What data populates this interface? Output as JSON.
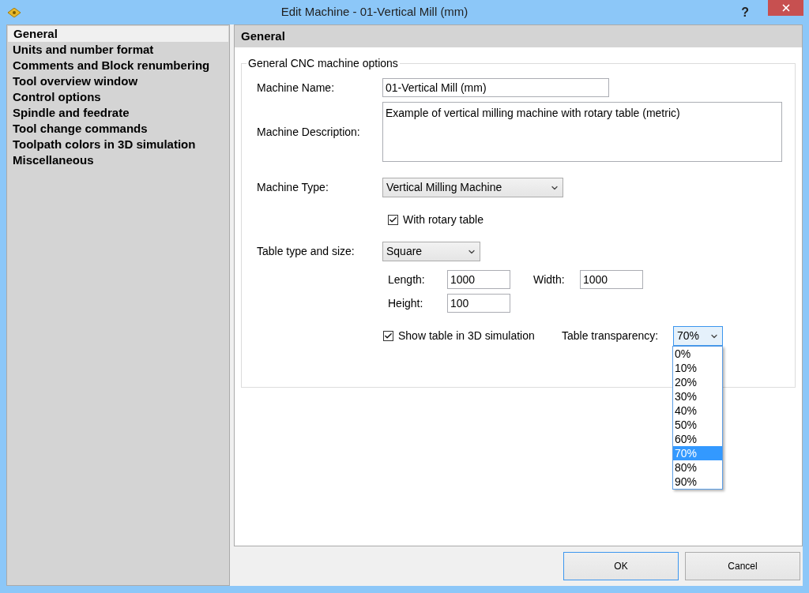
{
  "window": {
    "title": "Edit Machine - 01-Vertical Mill (mm)",
    "help": "?"
  },
  "sidebar": {
    "items": [
      {
        "label": "General",
        "selected": true
      },
      {
        "label": "Units and number format",
        "selected": false
      },
      {
        "label": "Comments and Block renumbering",
        "selected": false
      },
      {
        "label": "Tool overview window",
        "selected": false
      },
      {
        "label": "Control options",
        "selected": false
      },
      {
        "label": "Spindle and feedrate",
        "selected": false
      },
      {
        "label": "Tool change commands",
        "selected": false
      },
      {
        "label": "Toolpath colors in 3D simulation",
        "selected": false
      },
      {
        "label": "Miscellaneous",
        "selected": false
      }
    ]
  },
  "panel": {
    "title": "General",
    "group": {
      "legend": "General CNC machine options",
      "machine_name": {
        "label": "Machine Name:",
        "value": "01-Vertical Mill (mm)"
      },
      "machine_description": {
        "label": "Machine Description:",
        "value": "Example of vertical milling machine with rotary table (metric)"
      },
      "machine_type": {
        "label": "Machine Type:",
        "value": "Vertical Milling Machine"
      },
      "rotary_table": {
        "label": "With rotary table",
        "checked": true
      },
      "table_type": {
        "label": "Table type and size:",
        "value": "Square"
      },
      "length": {
        "label": "Length:",
        "value": "1000"
      },
      "width": {
        "label": "Width:",
        "value": "1000"
      },
      "height": {
        "label": "Height:",
        "value": "100"
      },
      "show_table": {
        "label": "Show table in 3D simulation",
        "checked": true
      },
      "transparency": {
        "label": "Table transparency:",
        "value": "70%",
        "expanded": true,
        "options": [
          {
            "label": "0%",
            "selected": false
          },
          {
            "label": "10%",
            "selected": false
          },
          {
            "label": "20%",
            "selected": false
          },
          {
            "label": "30%",
            "selected": false
          },
          {
            "label": "40%",
            "selected": false
          },
          {
            "label": "50%",
            "selected": false
          },
          {
            "label": "60%",
            "selected": false
          },
          {
            "label": "70%",
            "selected": true
          },
          {
            "label": "80%",
            "selected": false
          },
          {
            "label": "90%",
            "selected": false
          }
        ]
      }
    }
  },
  "buttons": [
    {
      "label": "OK",
      "default": true
    },
    {
      "label": "Cancel",
      "default": false
    }
  ]
}
